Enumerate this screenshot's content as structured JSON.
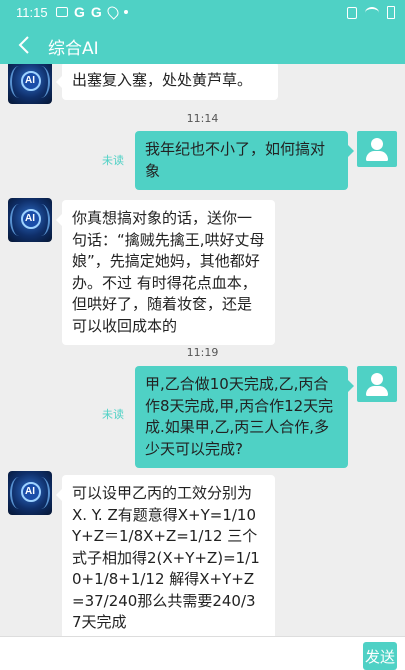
{
  "status_bar": {
    "time": "11:15",
    "notifications": [
      "image-icon",
      "google-icon",
      "google-icon",
      "location-icon",
      "dot-icon"
    ],
    "g_letter": "G",
    "system": [
      "vibrate-icon",
      "wifi-icon",
      "battery-icon"
    ]
  },
  "header": {
    "title": "综合AI",
    "accent_color": "#4fd1c5"
  },
  "messages": [
    {
      "sender": "ai",
      "text": "出塞复入塞，处处黄芦草。"
    },
    {
      "timestamp": "11:14"
    },
    {
      "sender": "user",
      "status": "未读",
      "text": "我年纪也不小了，如何搞对象"
    },
    {
      "sender": "ai",
      "text": "你真想搞对象的话，送你一句话：“擒贼先擒王,哄好丈母娘”，先搞定她妈，其他都好办。不过 有时得花点血本，但哄好了，随着妆奁，还是可以收回成本的"
    },
    {
      "timestamp": "11:19"
    },
    {
      "sender": "user",
      "status": "未读",
      "text": "甲,乙合做10天完成,乙,丙合作8天完成,甲,丙合作12天完成.如果甲,乙,丙三人合作,多少天可以完成?"
    },
    {
      "sender": "ai",
      "text": "可以设甲乙丙的工效分别为X. Y. Z有题意得X+Y=1/10 Y+Z＝1/8X+Z=1/12 三个式子相加得2(X+Y+Z)=1/10+1/8+1/12 解得X+Y+Z=37/240那么共需要240/37天完成"
    }
  ],
  "ai_avatar_label": "AI",
  "composer": {
    "input_value": "",
    "send_label": "发送"
  }
}
